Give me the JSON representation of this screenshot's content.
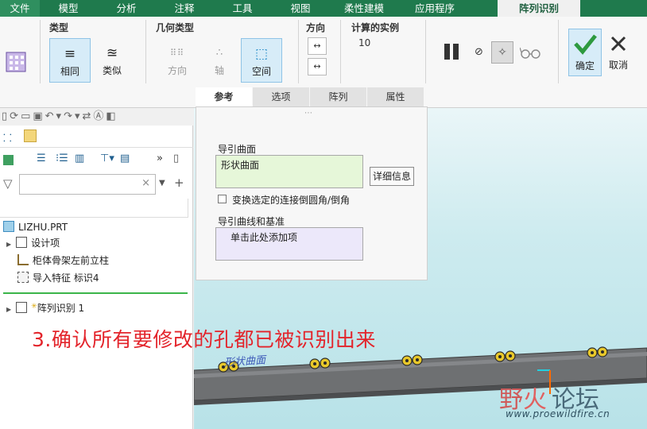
{
  "menu": {
    "items": [
      "文件",
      "模型",
      "分析",
      "注释",
      "工具",
      "视图",
      "柔性建模",
      "应用程序",
      "阵列识别"
    ]
  },
  "ribbon": {
    "type_group": {
      "label": "类型",
      "buttons": [
        {
          "label": "相同",
          "selected": true
        },
        {
          "label": "类似",
          "selected": false
        }
      ]
    },
    "geometry_group": {
      "label": "几何类型",
      "buttons": [
        {
          "label": "方向",
          "enabled": false
        },
        {
          "label": "轴",
          "enabled": false
        },
        {
          "label": "空间",
          "enabled": true,
          "selected": true
        }
      ]
    },
    "direction_group": {
      "label": "方向"
    },
    "calc_group": {
      "label": "计算的实例",
      "value": "10"
    },
    "confirm_label": "确定",
    "cancel_label": "取消"
  },
  "tabs": [
    "参考",
    "选项",
    "阵列",
    "属性"
  ],
  "panel": {
    "guide_surface_label": "导引曲面",
    "guide_surface_value": "形状曲面",
    "detail_button": "详细信息",
    "checkbox_label": "变换选定的连接倒圆角/倒角",
    "guide_curves_label": "导引曲线和基准",
    "guide_curves_value": "单击此处添加项"
  },
  "tree": {
    "root": "LIZHU.PRT",
    "items": [
      "设计项",
      "柜体骨架左前立柱",
      "导入特征 标识4"
    ],
    "pattern_item": "阵列识别 1"
  },
  "viewport": {
    "surface_label": "形状曲面"
  },
  "caption": "3.确认所有要修改的孔都已被识别出来",
  "watermark": {
    "text_a": "野",
    "text_b": "火",
    "text_c": "论坛",
    "url": "www.proewildfire.cn"
  },
  "colors": {
    "menu_bg": "#1f7a4d",
    "selected_bg": "#d7ecf8",
    "caption": "#e3242b",
    "guide_field": "#e6f7d9",
    "curves_field": "#ece8fa"
  }
}
